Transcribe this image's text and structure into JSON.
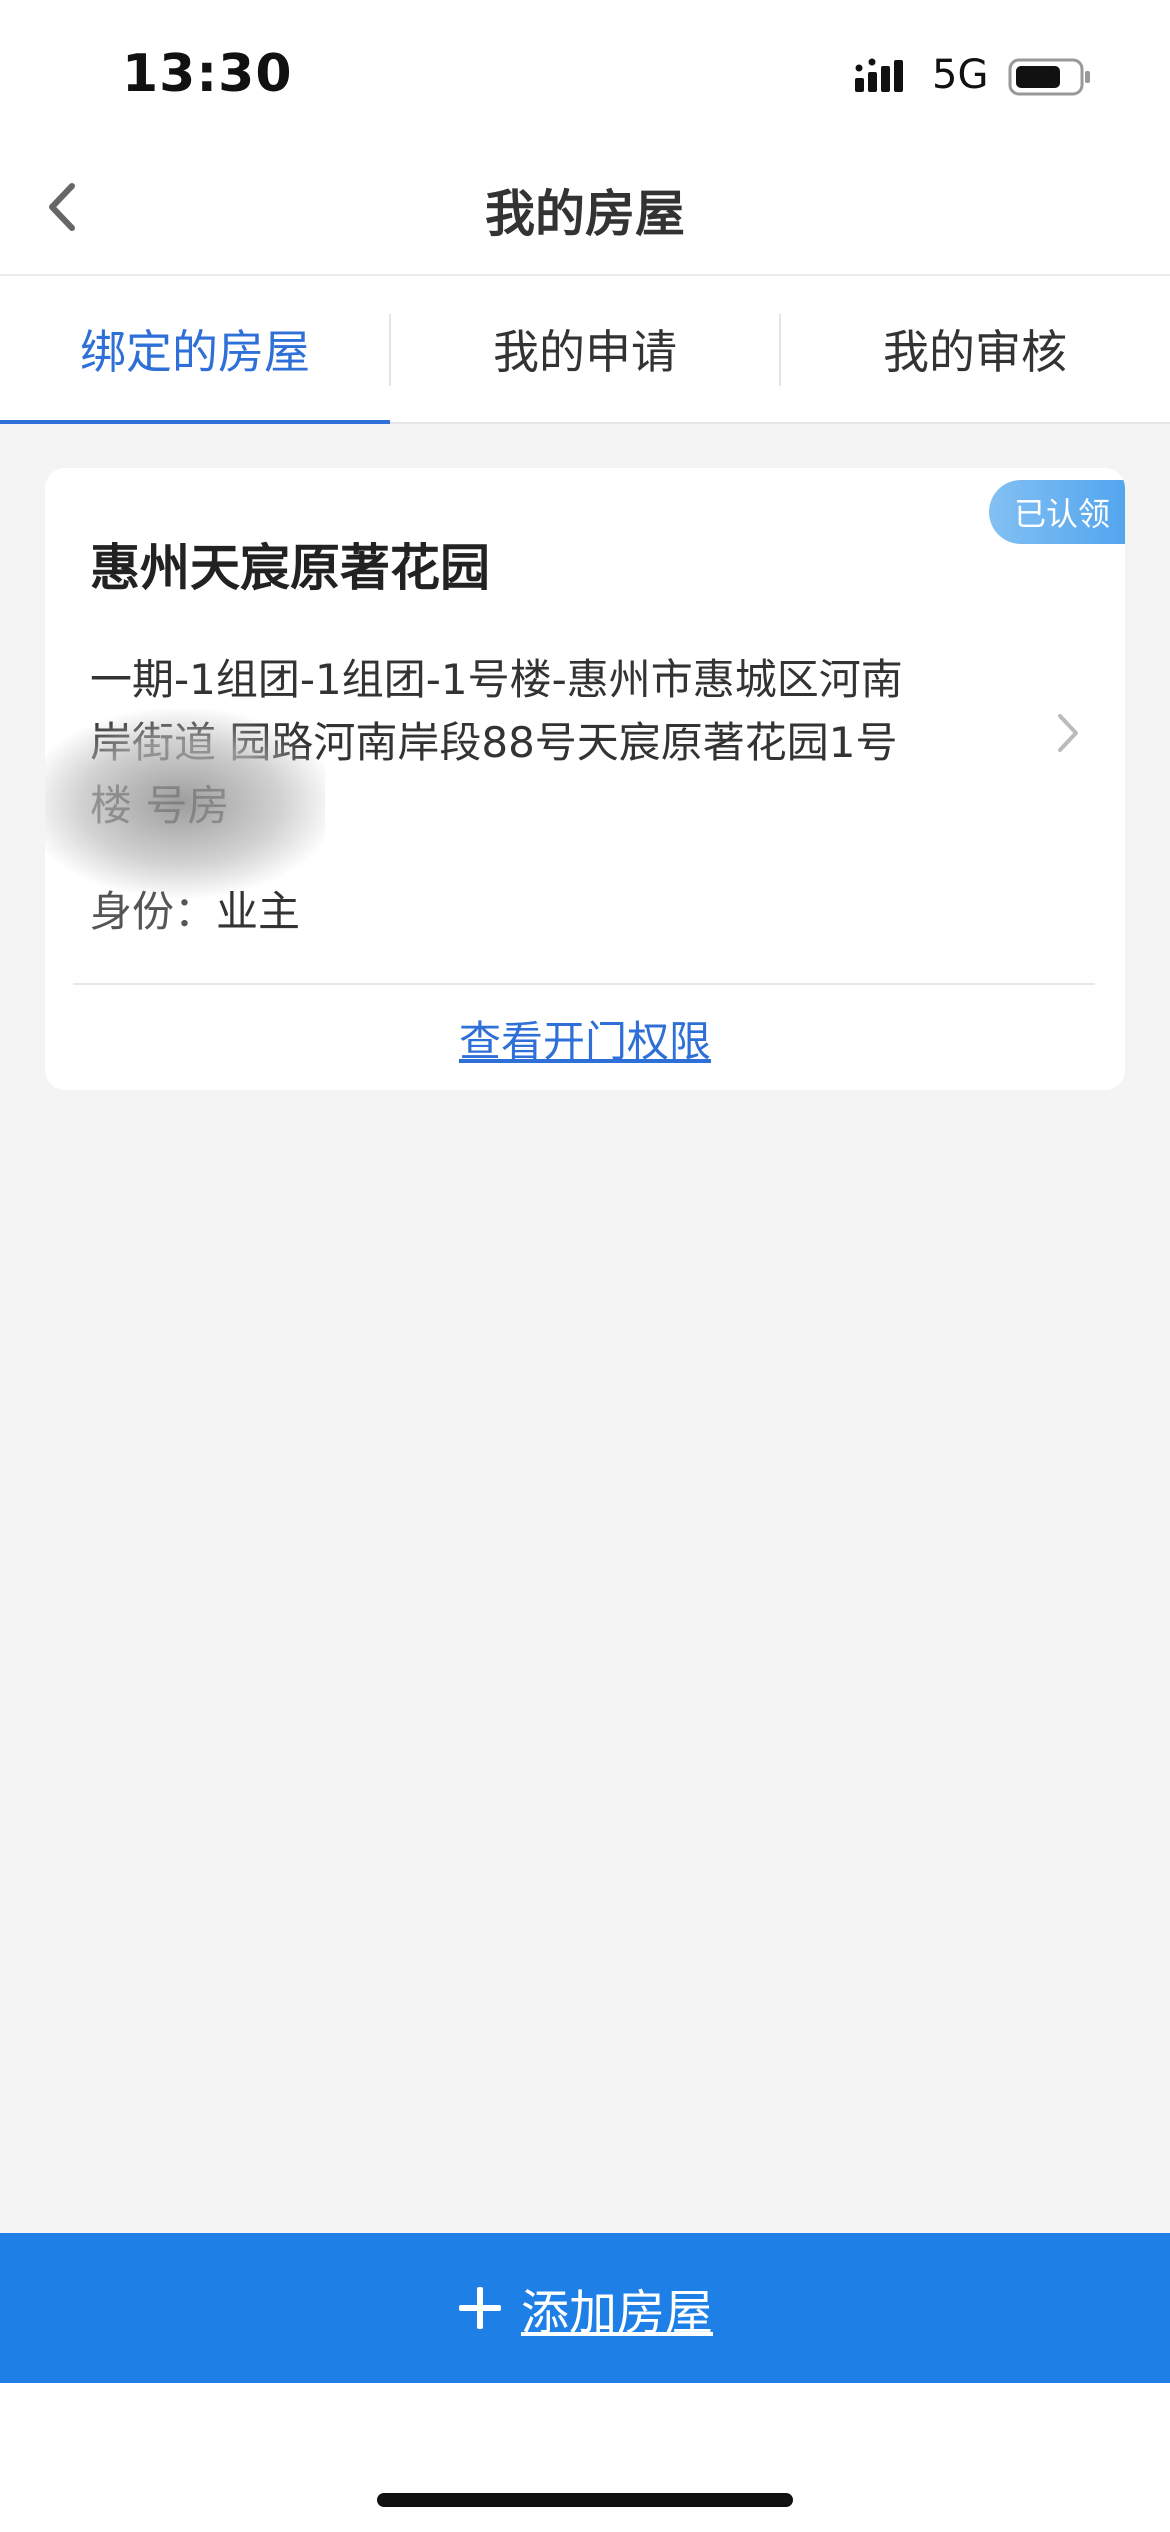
{
  "status_bar": {
    "time": "13:30",
    "network": "5G",
    "icons": [
      "signal-icon",
      "battery-icon"
    ]
  },
  "nav": {
    "title": "我的房屋",
    "back_icon": "chevron-left-icon"
  },
  "tabs": [
    {
      "label": "绑定的房屋",
      "active": true
    },
    {
      "label": "我的申请",
      "active": false
    },
    {
      "label": "我的审核",
      "active": false
    }
  ],
  "house_card": {
    "badge": "已认领",
    "community_name": "惠州天宸原著花园",
    "address_line1": "一期-1组团-1组团-1号楼-惠州市惠城区河南",
    "address_line2": "岸街道     园路河南岸段88号天宸原著花园1号",
    "address_line3": "楼        号房",
    "identity_label": "身份：",
    "identity_value": "业主",
    "view_access": "查看开门权限"
  },
  "add_button": {
    "label": "添加房屋",
    "icon": "plus-icon"
  },
  "colors": {
    "accent": "#2f6fd8",
    "button": "#1e7fe7",
    "badge": "#62b0f0",
    "background": "#f4f4f4"
  }
}
